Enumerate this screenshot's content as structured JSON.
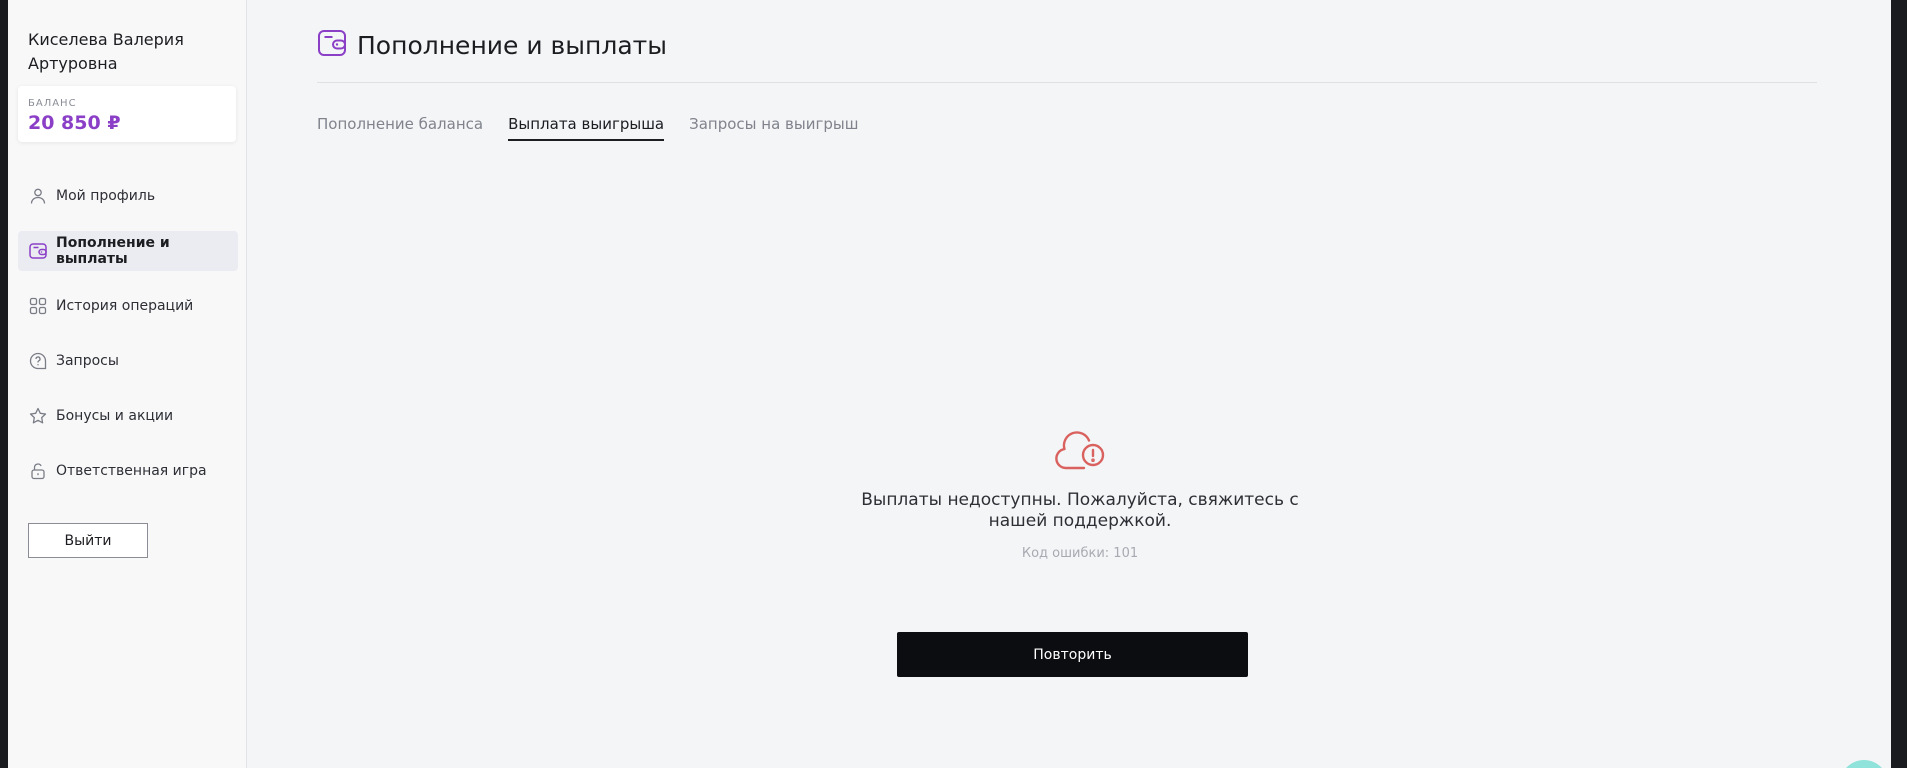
{
  "sidebar": {
    "user_name": "Киселева Валерия Артуровна",
    "balance": {
      "label": "БАЛАНС",
      "value": "20 850 ₽"
    },
    "items": [
      {
        "label": "Мой профиль",
        "icon": "user-icon",
        "active": false
      },
      {
        "label": "Пополнение и выплаты",
        "icon": "wallet-icon",
        "active": true
      },
      {
        "label": "История операций",
        "icon": "grid-icon",
        "active": false
      },
      {
        "label": "Запросы",
        "icon": "question-bubble-icon",
        "active": false
      },
      {
        "label": "Бонусы и акции",
        "icon": "star-icon",
        "active": false
      },
      {
        "label": "Ответственная игра",
        "icon": "lock-icon",
        "active": false
      }
    ],
    "logout_label": "Выйти"
  },
  "main": {
    "title": "Пополнение и выплаты",
    "title_icon": "wallet-icon",
    "tabs": [
      {
        "label": "Пополнение баланса",
        "active": false
      },
      {
        "label": "Выплата выигрыша",
        "active": true
      },
      {
        "label": "Запросы на выигрыш",
        "active": false
      }
    ],
    "error": {
      "icon": "cloud-error-icon",
      "message": "Выплаты недоступны. Пожалуйста, свяжитесь с нашей поддержкой.",
      "code": "Код ошибки: 101"
    },
    "retry_label": "Повторить"
  },
  "colors": {
    "accent": "#8b3fc7",
    "error": "#d9625f",
    "primary_button": "#0c0d10"
  }
}
